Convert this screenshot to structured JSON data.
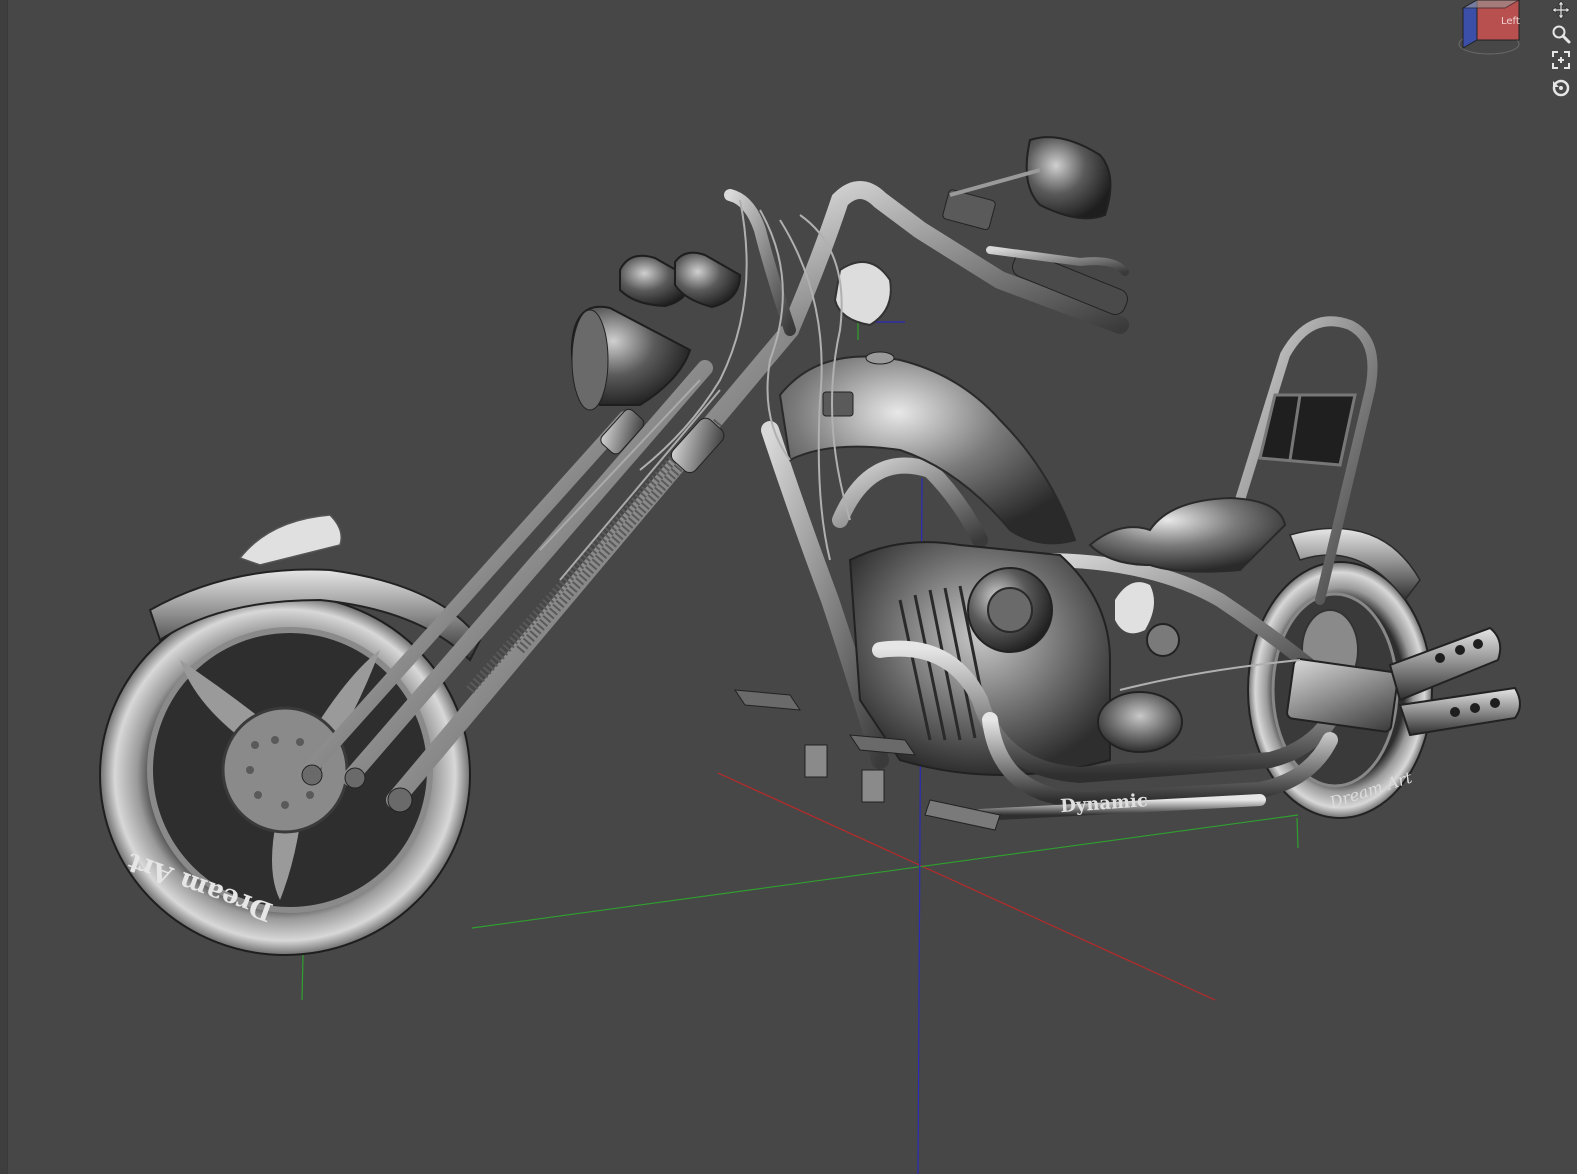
{
  "viewport": {
    "background_color": "#474747"
  },
  "view_cube": {
    "face_label": "Left",
    "front_color": "#b85050",
    "side_color": "#3c4fa8"
  },
  "nav_tools": {
    "icons": [
      "pan-icon",
      "zoom-icon",
      "zoom-extents-icon",
      "orbit-icon"
    ]
  },
  "axes": {
    "x_color": "#b82a2a",
    "y_color": "#2fa02f",
    "z_color": "#2a2ab8"
  },
  "model": {
    "tank_brand_text": "Dynamic",
    "front_tire_text": "Dream Art",
    "rear_tire_text": "Dream Art",
    "material_color": "#8e8e8e"
  }
}
